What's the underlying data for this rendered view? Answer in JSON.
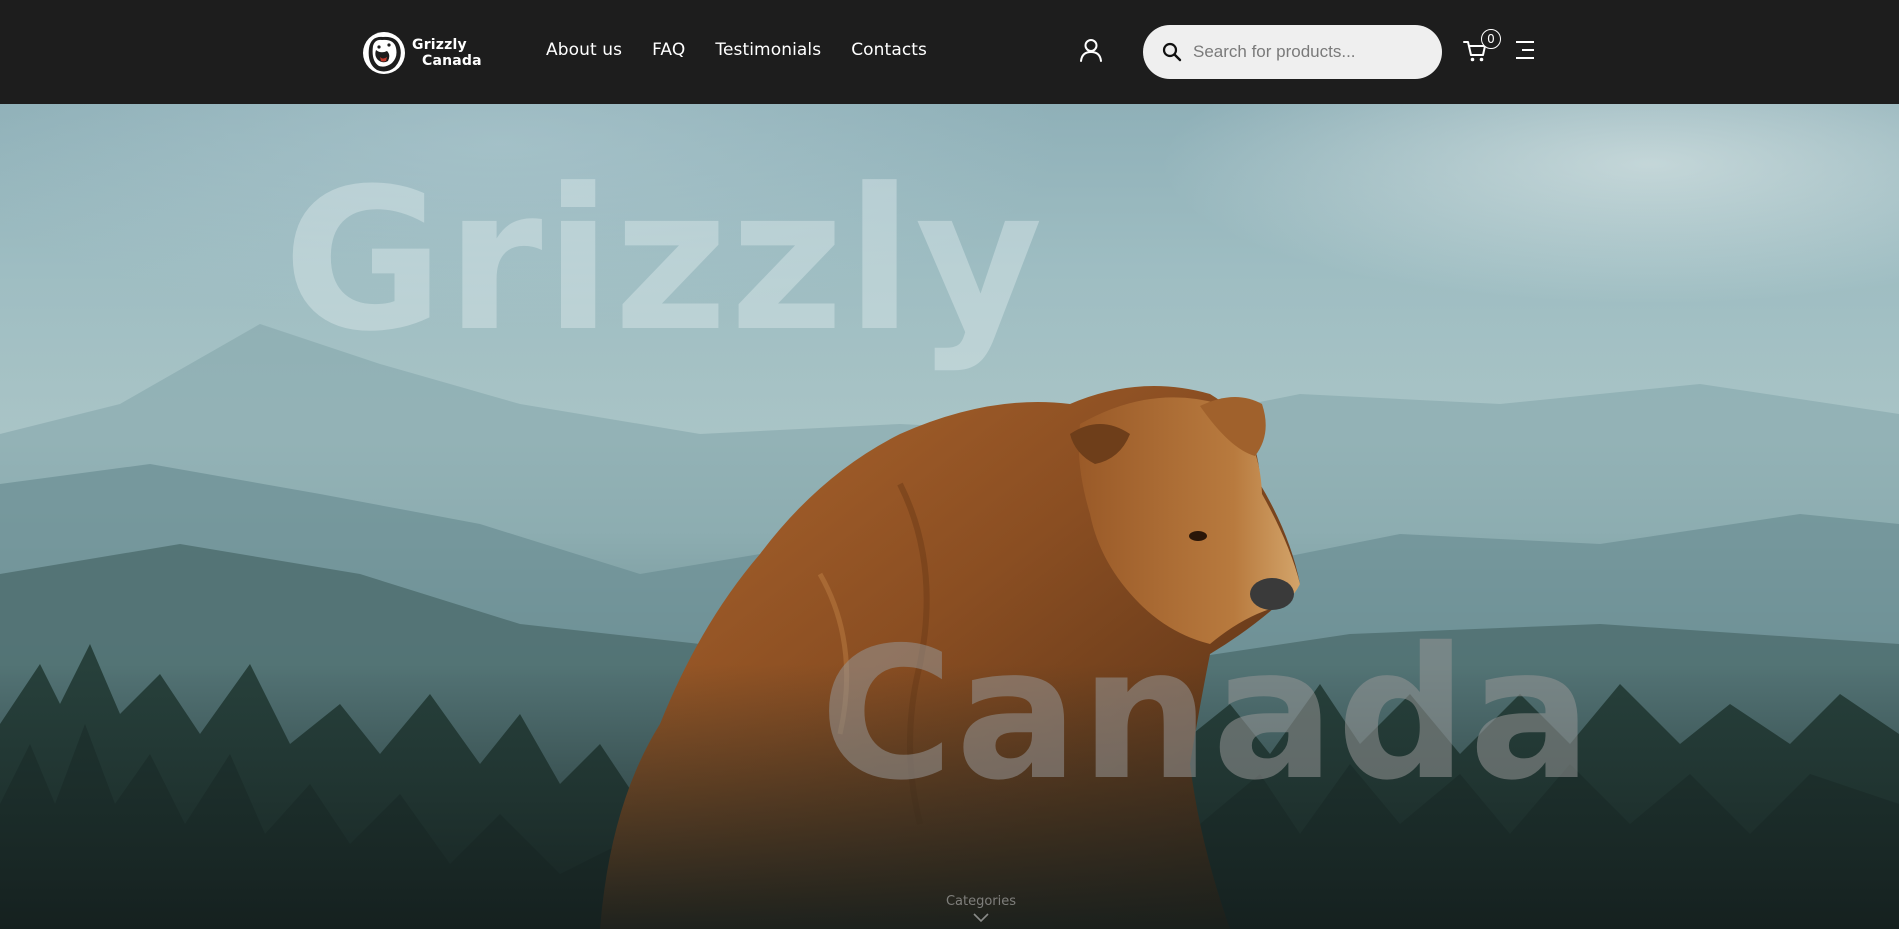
{
  "header": {
    "logo": {
      "line1": "Grizzly",
      "line2": "Canada",
      "icon": "bear-head-logo-icon"
    },
    "nav": [
      {
        "label": "About us"
      },
      {
        "label": "FAQ"
      },
      {
        "label": "Testimonials"
      },
      {
        "label": "Contacts"
      }
    ],
    "user_icon": "user-icon",
    "search": {
      "placeholder": "Search for products...",
      "value": "",
      "icon": "search-icon"
    },
    "cart": {
      "icon": "cart-icon",
      "count": "0"
    },
    "menu_icon": "hamburger-menu-icon"
  },
  "hero": {
    "word1": "Grizzly",
    "word2": "Canada",
    "image": "grizzly-bear-in-misty-forest",
    "categories_label": "Categories",
    "scroll_icon": "chevron-down-icon"
  },
  "colors": {
    "header_bg": "#1d1d1d",
    "search_bg": "#efefef",
    "nav_text": "#ffffff"
  }
}
